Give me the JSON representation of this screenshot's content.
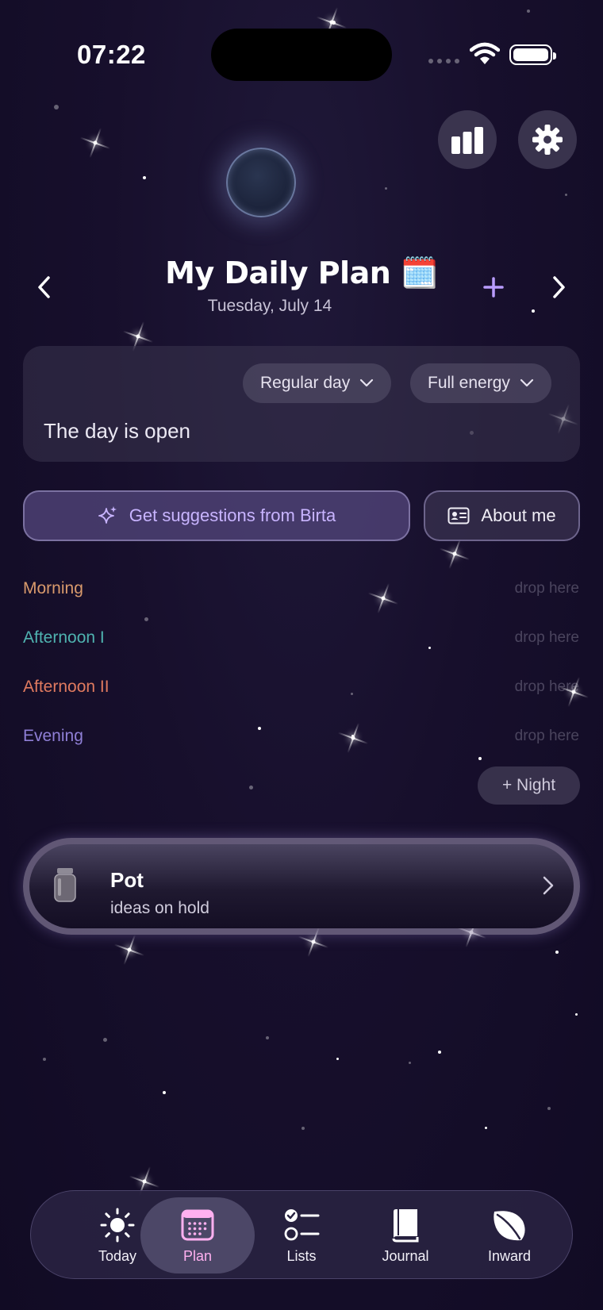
{
  "status_bar": {
    "time": "07:22"
  },
  "header": {
    "title": "My Daily Plan 🗓️",
    "date": "Tuesday, July 14"
  },
  "day_card": {
    "day_type": "Regular day",
    "energy": "Full energy",
    "status": "The day is open"
  },
  "actions": {
    "suggest_label": "Get suggestions from Birta",
    "about_label": "About me"
  },
  "slots": [
    {
      "label": "Morning",
      "drop": "drop here",
      "color": "#d99a6c"
    },
    {
      "label": "Afternoon I",
      "drop": "drop here",
      "color": "#4fb3b0"
    },
    {
      "label": "Afternoon II",
      "drop": "drop here",
      "color": "#e07a5f"
    },
    {
      "label": "Evening",
      "drop": "drop here",
      "color": "#8f7fd6"
    }
  ],
  "night_button": "+ Night",
  "pot": {
    "title": "Pot",
    "subtitle": "ideas on hold"
  },
  "tabs": [
    {
      "label": "Today",
      "icon": "sun-icon"
    },
    {
      "label": "Plan",
      "icon": "calendar-icon"
    },
    {
      "label": "Lists",
      "icon": "checklist-icon"
    },
    {
      "label": "Journal",
      "icon": "book-icon"
    },
    {
      "label": "Inward",
      "icon": "leaf-icon"
    }
  ],
  "colors": {
    "accent": "#c8b4ff",
    "plan_tab": "#ffb0f0",
    "add": "#b99cff"
  }
}
